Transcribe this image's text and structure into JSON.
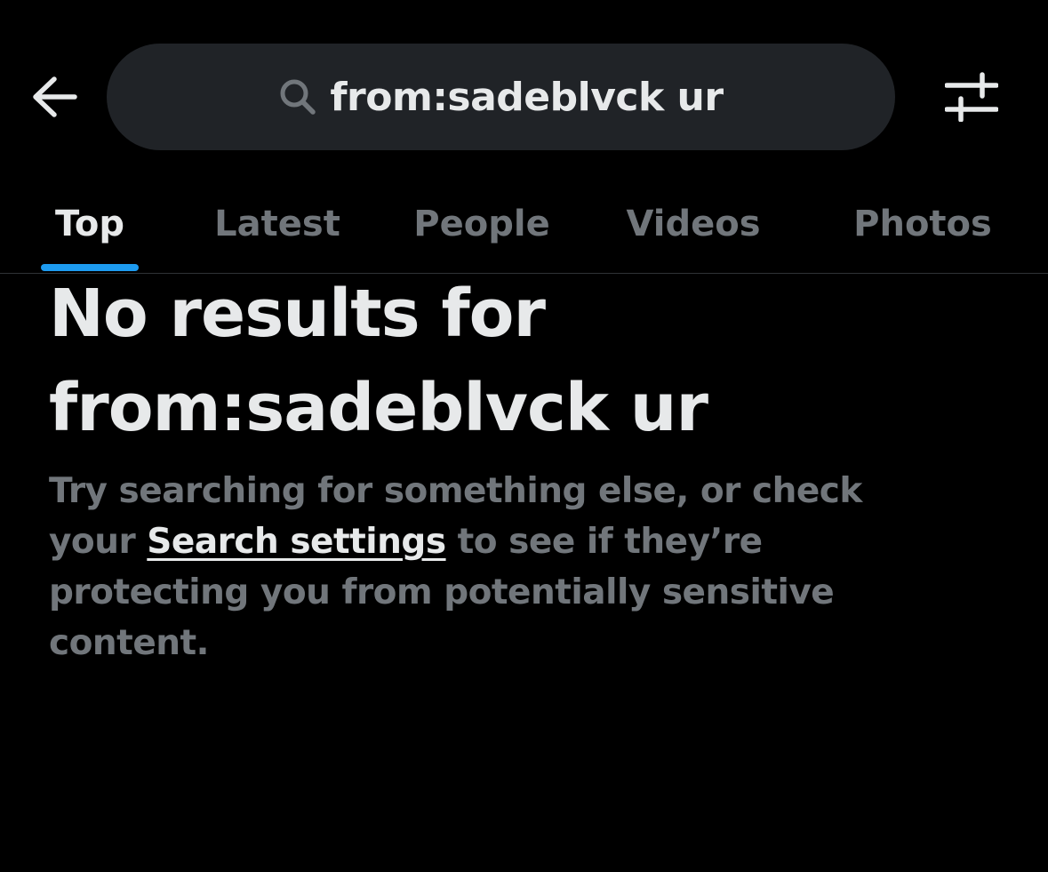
{
  "header": {
    "back_icon": "arrow-left-icon",
    "search": {
      "icon": "search-icon",
      "value": "from:sadeblvck ur"
    },
    "filter_icon": "sliders-icon"
  },
  "tabs": [
    {
      "label": "Top",
      "active": true
    },
    {
      "label": "Latest",
      "active": false
    },
    {
      "label": "People",
      "active": false
    },
    {
      "label": "Videos",
      "active": false
    },
    {
      "label": "Photos",
      "active": false
    }
  ],
  "empty_state": {
    "title": "No results for from:sadeblvck ur",
    "description_before": "Try searching for something else, or check your ",
    "link_label": "Search settings",
    "description_after": " to see if they’re protecting you from potentially sensitive content."
  },
  "colors": {
    "background": "#000000",
    "search_bg": "#202327",
    "primary_text": "#e7e9ea",
    "secondary_text": "#71767b",
    "accent": "#1d9bf0",
    "divider": "#2f3336"
  }
}
